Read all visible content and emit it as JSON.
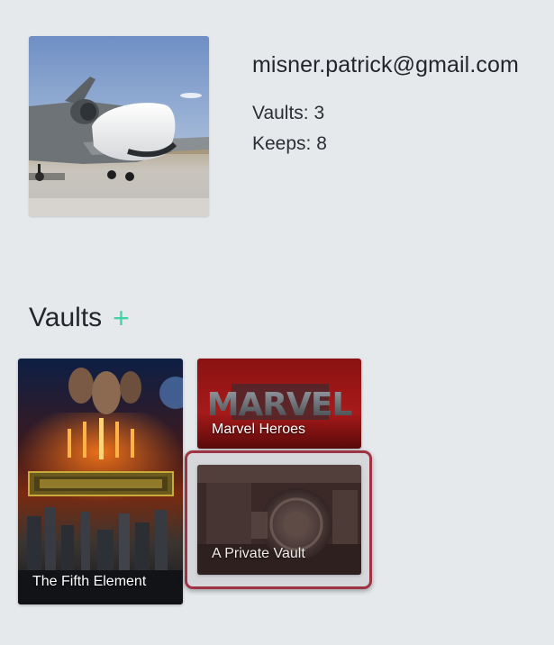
{
  "profile": {
    "email": "misner.patrick@gmail.com",
    "vaults_stat": "Vaults: 3",
    "keeps_stat": "Keeps: 8",
    "avatar_icon": "drone-aircraft-photo"
  },
  "vaults_section": {
    "title": "Vaults",
    "add_label": "+",
    "add_color": "#41d3a6"
  },
  "vaults": [
    {
      "name": "The Fifth Element"
    },
    {
      "name": "Marvel Heroes",
      "logo_text": "MARVEL"
    },
    {
      "name": "A Private Vault",
      "selected": true
    }
  ],
  "colors": {
    "background": "#e6e9ec",
    "selection_border": "#9e3344"
  }
}
